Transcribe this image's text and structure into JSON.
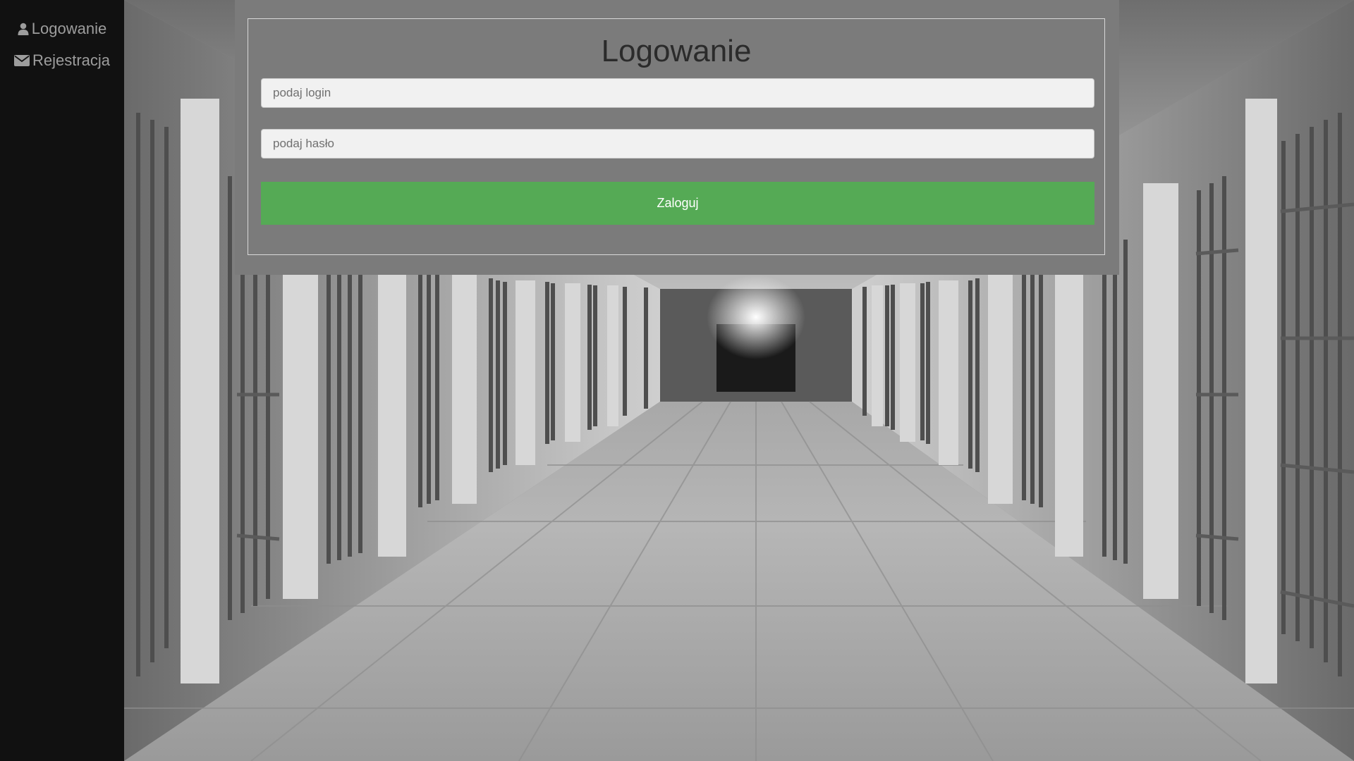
{
  "sidebar": {
    "items": [
      {
        "label": "Logowanie",
        "icon": "user-icon"
      },
      {
        "label": "Rejestracja",
        "icon": "envelope-icon"
      }
    ]
  },
  "login_form": {
    "title": "Logowanie",
    "login_placeholder": "podaj login",
    "login_value": "",
    "password_placeholder": "podaj hasło",
    "password_value": "",
    "submit_label": "Zaloguj"
  },
  "colors": {
    "sidebar_bg": "#111111",
    "nav_text": "#9d9d9d",
    "panel_bg": "#7b7b7b",
    "submit_bg": "#55aa55",
    "input_bg": "#f1f1f1"
  }
}
